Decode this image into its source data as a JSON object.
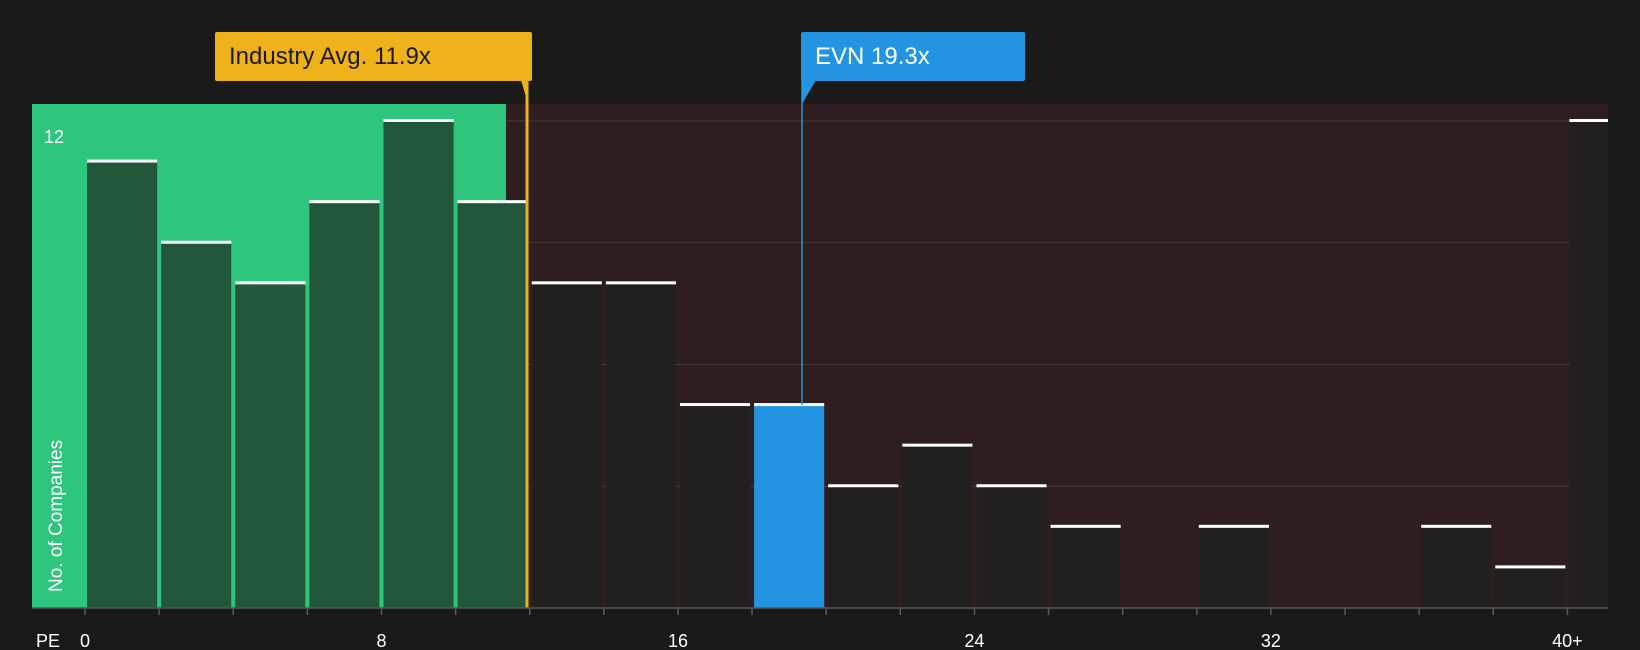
{
  "chart_data": {
    "type": "bar",
    "xlabel": "PE",
    "ylabel": "No. of Companies",
    "ylim": [
      0,
      12
    ],
    "y_tick_labels": [
      "12"
    ],
    "x_tick_labels": [
      "0",
      "8",
      "16",
      "24",
      "32",
      "40+"
    ],
    "bin_width": 2,
    "bins": [
      {
        "x0": 0,
        "value": 11,
        "zone": "below"
      },
      {
        "x0": 2,
        "value": 9,
        "zone": "below"
      },
      {
        "x0": 4,
        "value": 8,
        "zone": "below"
      },
      {
        "x0": 6,
        "value": 10,
        "zone": "below"
      },
      {
        "x0": 8,
        "value": 12,
        "zone": "below"
      },
      {
        "x0": 10,
        "value": 10,
        "zone": "below"
      },
      {
        "x0": 12,
        "value": 8,
        "zone": "above"
      },
      {
        "x0": 14,
        "value": 8,
        "zone": "above"
      },
      {
        "x0": 16,
        "value": 5,
        "zone": "above"
      },
      {
        "x0": 18,
        "value": 5,
        "zone": "highlight"
      },
      {
        "x0": 20,
        "value": 3,
        "zone": "above"
      },
      {
        "x0": 22,
        "value": 4,
        "zone": "above"
      },
      {
        "x0": 24,
        "value": 3,
        "zone": "above"
      },
      {
        "x0": 26,
        "value": 2,
        "zone": "above"
      },
      {
        "x0": 28,
        "value": 0,
        "zone": "above"
      },
      {
        "x0": 30,
        "value": 2,
        "zone": "above"
      },
      {
        "x0": 32,
        "value": 0,
        "zone": "above"
      },
      {
        "x0": 34,
        "value": 0,
        "zone": "above"
      },
      {
        "x0": 36,
        "value": 2,
        "zone": "above"
      },
      {
        "x0": 38,
        "value": 1,
        "zone": "above"
      },
      {
        "x0": 40,
        "value": 12,
        "zone": "above"
      }
    ],
    "markers": [
      {
        "name": "industry",
        "label": "Industry Avg. 11.9x",
        "x": 11.9,
        "color": "#f0b21b"
      },
      {
        "name": "evn",
        "label": "EVN 19.3x",
        "x": 19.3,
        "color": "#2394e0"
      }
    ],
    "colors": {
      "background": "#1a1a1a",
      "below_zone": "#2ec57c",
      "below_bar": "#23573b",
      "above_zone": "#2e1e1f",
      "above_bar": "#221f1f",
      "highlight_bar": "#2394e0",
      "cap": "#ffffff"
    }
  }
}
